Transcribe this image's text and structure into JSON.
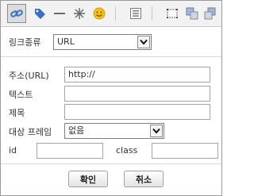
{
  "toolbar": {
    "icons": [
      "link-icon",
      "tag-icon",
      "horizontal-rule-icon",
      "special-char-icon",
      "emoticon-icon",
      "list-icon",
      "table-icon",
      "copy-icon",
      "layer-icon"
    ]
  },
  "form": {
    "link_type_label": "링크종류",
    "link_type_value": "URL",
    "address_label": "주소(URL)",
    "address_value": "http://",
    "text_label": "텍스트",
    "text_value": "",
    "title_label": "제목",
    "title_value": "",
    "target_frame_label": "대상 프레임",
    "target_frame_value": "없음",
    "id_label": "id",
    "id_value": "",
    "class_label": "class",
    "class_value": ""
  },
  "buttons": {
    "confirm_label": "확인",
    "cancel_label": "취소"
  },
  "colors": {
    "border": "#9a9a9a",
    "toolbar_bg": "#f2f2f2",
    "link_icon": "#3b73c8",
    "emoticon": "#f3c21a"
  }
}
